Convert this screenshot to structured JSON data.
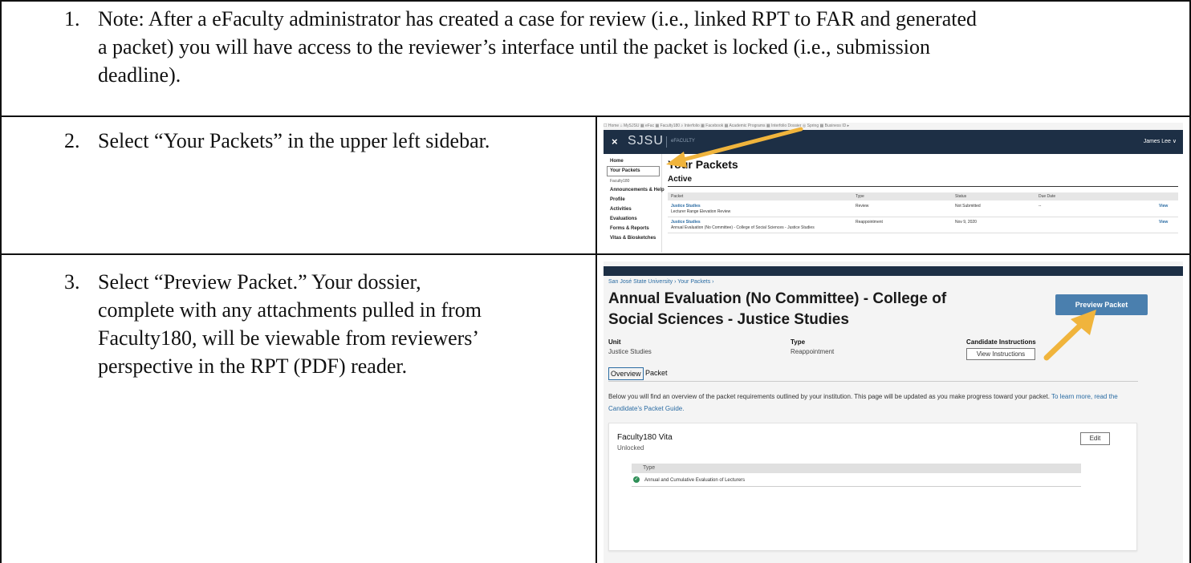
{
  "steps": [
    {
      "num": "1.",
      "line1": "Note: After a eFaculty administrator has created a case for review (i.e., linked RPT to FAR and generated",
      "line2": "a packet) you will have access to the reviewer’s interface until the packet is locked (i.e., submission",
      "line3": "deadline)."
    },
    {
      "num": "2.",
      "line1": "Select “Your Packets” in the upper left sidebar."
    },
    {
      "num": "3.",
      "line1": "Select “Preview Packet.” Your dossier,",
      "line2": "complete with any attachments pulled in from",
      "line3": "Faculty180, will be viewable from reviewers’",
      "line4": "perspective in the RPT (PDF) reader."
    }
  ],
  "shot1": {
    "browser_bar": "☐ Home  ⌂ MySJSU  ▦ eFac  ▦ Faculty180  ⌕ Interfolio  ▦ Facebook  ▦ Academic Programs  ▦ Interfolio Dossier  ◎ Spring  ▦ Business ID ▸",
    "close": "×",
    "logo": "SJSU",
    "logo_sub": "eFACULTY",
    "user": "James Lee ∨",
    "sidebar": {
      "home": "Home",
      "your_packets": "Your Packets",
      "faculty180": "Faculty180",
      "announcements": "Announcements & Help",
      "profile": "Profile",
      "activities": "Activities",
      "evaluations": "Evaluations",
      "forms": "Forms & Reports",
      "vitas": "Vitas & Biosketches"
    },
    "page_title": "Your Packets",
    "section": "Active",
    "columns": [
      "Packet",
      "Type",
      "Status",
      "Due Date",
      ""
    ],
    "rows": [
      {
        "packet": "Justice Studies",
        "sub": "Lecturer Range Elevation Review",
        "type": "Review",
        "status": "Not Submitted",
        "due": "--",
        "action": "View"
      },
      {
        "packet": "Justice Studies",
        "sub": "Annual Evaluation (No Committee) - College of Social Sciences - Justice Studies",
        "type": "Reappointment",
        "status": "Nov 9, 2020",
        "due": "",
        "action": "View"
      }
    ]
  },
  "shot2": {
    "breadcrumb": "San José State University  ›  Your Packets  ›",
    "title": "Annual Evaluation (No Committee) - College of Social Sciences - Justice Studies",
    "preview_button": "Preview Packet",
    "unit_label": "Unit",
    "unit_value": "Justice Studies",
    "type_label": "Type",
    "type_value": "Reappointment",
    "instructions_label": "Candidate Instructions",
    "instructions_button": "View Instructions",
    "tab_overview": "Overview",
    "tab_packet": "Packet",
    "description": "Below you will find an overview of the packet requirements outlined by your institution. This page will be updated as you make progress toward your packet.",
    "description_link": "To learn more, read the Candidate's Packet Guide.",
    "card_title": "Faculty180 Vita",
    "card_status": "Unlocked",
    "edit_button": "Edit",
    "table_header": "Type",
    "table_row": "Annual and Cumulative Evaluation of Lecturers"
  },
  "colors": {
    "navbar": "#1d2f45",
    "link": "#2b6ca3",
    "button": "#4a7fae",
    "arrow": "#f0b43c"
  }
}
